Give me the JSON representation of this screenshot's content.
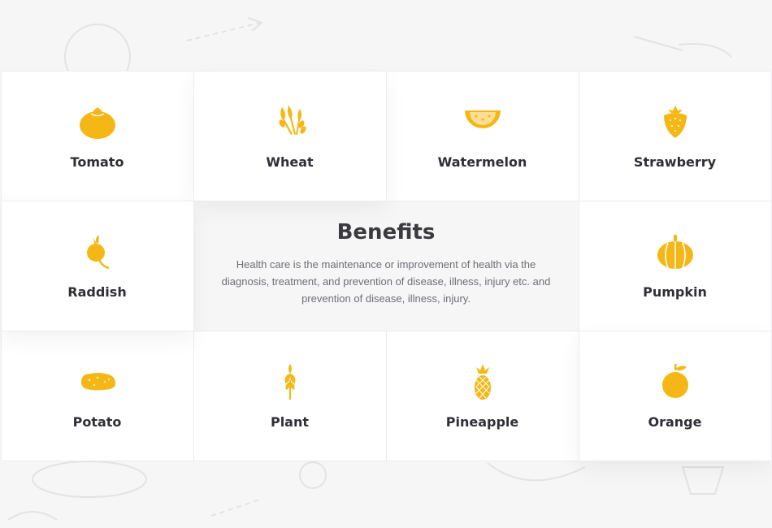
{
  "colors": {
    "accent": "#f5b715",
    "text": "#2f2f36",
    "muted": "#6e6e75"
  },
  "benefits": {
    "title": "Benefits",
    "description": "Health care is the maintenance or improvement of health via the diagnosis, treatment, and prevention of disease, illness, injury etc. and prevention of disease, illness, injury."
  },
  "items": [
    {
      "label": "Tomato",
      "icon": "tomato-icon"
    },
    {
      "label": "Wheat",
      "icon": "wheat-icon"
    },
    {
      "label": "Watermelon",
      "icon": "watermelon-icon"
    },
    {
      "label": "Strawberry",
      "icon": "strawberry-icon"
    },
    {
      "label": "Raddish",
      "icon": "raddish-icon"
    },
    {
      "label": "Pumpkin",
      "icon": "pumpkin-icon"
    },
    {
      "label": "Potato",
      "icon": "potato-icon"
    },
    {
      "label": "Plant",
      "icon": "plant-icon"
    },
    {
      "label": "Pineapple",
      "icon": "pineapple-icon"
    },
    {
      "label": "Orange",
      "icon": "orange-icon"
    }
  ]
}
